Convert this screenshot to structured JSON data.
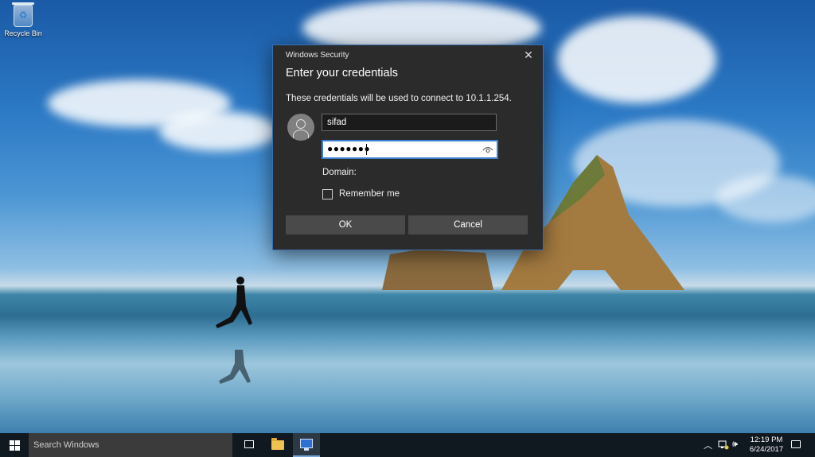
{
  "desktop": {
    "recycle_bin_label": "Recycle Bin"
  },
  "dialog": {
    "caption": "Windows Security",
    "close_glyph": "✕",
    "title": "Enter your credentials",
    "description": "These credentials will be used to connect to 10.1.1.254.",
    "username_value": "sifad",
    "password_masked": "●●●●●●●",
    "domain_label": "Domain:",
    "remember_label": "Remember me",
    "remember_checked": false,
    "ok_label": "OK",
    "cancel_label": "Cancel",
    "accent_color": "#3d7fd4"
  },
  "taskbar": {
    "search_placeholder": "Search Windows",
    "tray": {
      "chevron_glyph": "︿",
      "network_icon": "network-icon",
      "volume_glyph": "🕪",
      "time": "12:19 PM",
      "date": "6/24/2017"
    }
  }
}
